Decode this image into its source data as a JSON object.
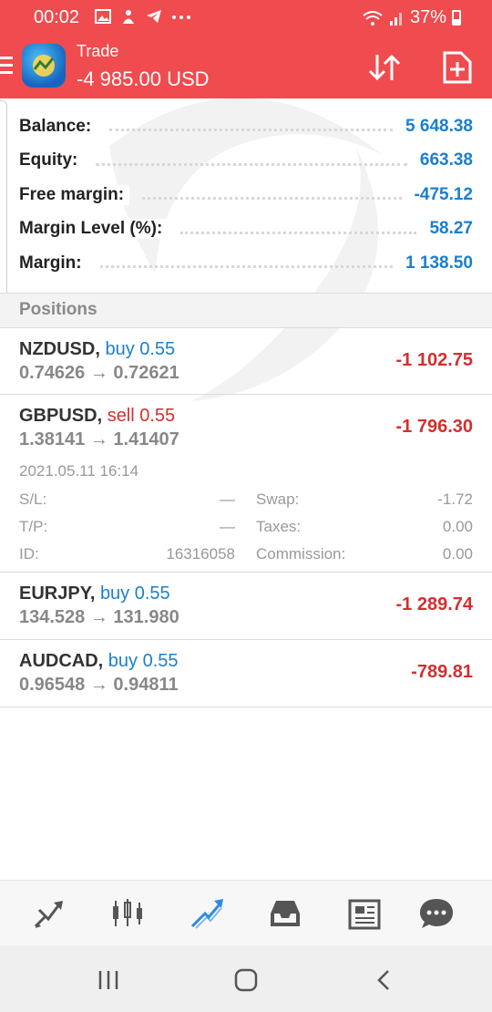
{
  "status_bar": {
    "time": "00:02",
    "battery": "37%"
  },
  "header": {
    "title": "Trade",
    "subtitle": "-4 985.00 USD"
  },
  "summary": [
    {
      "label": "Balance:",
      "value": "5 648.38"
    },
    {
      "label": "Equity:",
      "value": "663.38"
    },
    {
      "label": "Free margin:",
      "value": "-475.12"
    },
    {
      "label": "Margin Level (%):",
      "value": "58.27"
    },
    {
      "label": "Margin:",
      "value": "1 138.50"
    }
  ],
  "positions_heading": "Positions",
  "positions": [
    {
      "symbol": "NZDUSD,",
      "side": "buy 0.55",
      "prices": "0.74626 → 0.72621",
      "profit": "-1 102.75"
    },
    {
      "symbol": "GBPUSD,",
      "side": "sell 0.55",
      "prices": "1.38141 → 1.41407",
      "profit": "-1 796.30",
      "details": {
        "time": "2021.05.11 16:14",
        "sl_label": "S/L:",
        "sl_value": "—",
        "tp_label": "T/P:",
        "tp_value": "—",
        "id_label": "ID:",
        "id_value": "16316058",
        "swap_label": "Swap:",
        "swap_value": "-1.72",
        "taxes_label": "Taxes:",
        "taxes_value": "0.00",
        "commission_label": "Commission:",
        "commission_value": "0.00"
      }
    },
    {
      "symbol": "EURJPY,",
      "side": "buy 0.55",
      "prices": "134.528 → 131.980",
      "profit": "-1 289.74"
    },
    {
      "symbol": "AUDCAD,",
      "side": "buy 0.55",
      "prices": "0.96548 → 0.94811",
      "profit": "-789.81"
    }
  ],
  "tabs": [
    {
      "icon": "quotes-icon"
    },
    {
      "icon": "chart-icon"
    },
    {
      "icon": "trade-icon",
      "active": true
    },
    {
      "icon": "history-icon"
    },
    {
      "icon": "news-icon"
    },
    {
      "icon": "messages-icon"
    }
  ],
  "colors": {
    "header": "#f04b4e",
    "positive_blue": "#1a7fd0",
    "negative_red": "#d32f2f"
  }
}
